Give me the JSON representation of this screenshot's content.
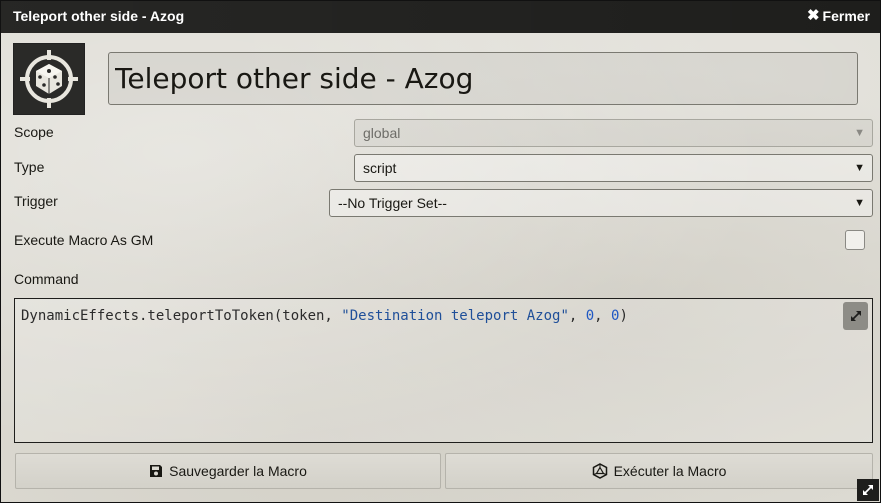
{
  "window": {
    "title": "Teleport other side - Azog",
    "close_label": "Fermer"
  },
  "macro": {
    "name": "Teleport other side - Azog",
    "icon": "dice-icon"
  },
  "fields": {
    "scope_label": "Scope",
    "scope_value": "global",
    "type_label": "Type",
    "type_value": "script",
    "trigger_label": "Trigger",
    "trigger_value": "--No Trigger Set--",
    "gm_label": "Execute Macro As GM",
    "gm_checked": false,
    "command_label": "Command"
  },
  "command": {
    "prefix": "DynamicEffects.teleportToToken(token, ",
    "string": "\"Destination teleport Azog\"",
    "sep1": ", ",
    "num1": "0",
    "sep2": ", ",
    "num2": "0",
    "suffix": ")"
  },
  "buttons": {
    "save_label": "Sauvegarder la Macro",
    "execute_label": "Exécuter la Macro"
  },
  "colors": {
    "titlebar": "#1e1e1c",
    "panel": "#dcdad2",
    "code_string": "#1f4f99",
    "code_number": "#1f58c4"
  }
}
